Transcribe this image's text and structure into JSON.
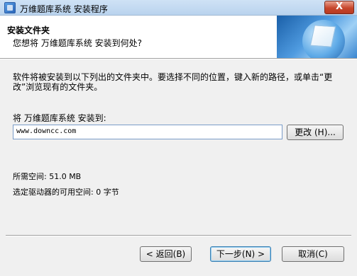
{
  "window": {
    "title": "万维题库系统 安装程序",
    "close_label": "X"
  },
  "header": {
    "title": "安装文件夹",
    "subtitle": "您想将 万维题库系统 安装到何处?"
  },
  "main": {
    "description": "软件将被安装到以下列出的文件夹中。要选择不同的位置，键入新的路径，或单击“更改”浏览现有的文件夹。",
    "destination_label": "将 万维题库系统 安装到:",
    "path_value": "www.downcc.com",
    "change_button": "更改 (H)...",
    "space_required": "所需空间: 51.0 MB",
    "space_available": "选定驱动器的可用空间: 0 字节"
  },
  "footer": {
    "back_button": "< 返回(B)",
    "next_button": "下一步(N) >",
    "cancel_button": "取消(C)"
  },
  "icons": {
    "app": "installer-app-icon",
    "header_art": "globe-cube-icon"
  }
}
